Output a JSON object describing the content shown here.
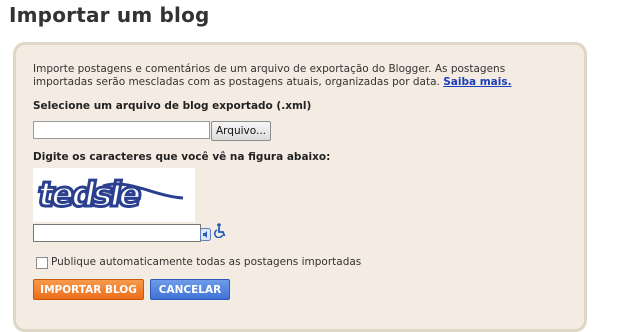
{
  "page": {
    "title": "Importar um blog"
  },
  "intro": {
    "text": "Importe postagens e comentários de um arquivo de exportação do Blogger. As postagens importadas serão mescladas com as postagens atuais, organizadas por data.",
    "link": "Saiba mais."
  },
  "file": {
    "label": "Selecione um arquivo de blog exportado (.xml)",
    "value": "",
    "button": "Arquivo..."
  },
  "captcha": {
    "label": "Digite os caracteres que você vê na figura abaixo:",
    "image_text": "tedsle",
    "value": ""
  },
  "autopublish": {
    "checked": false,
    "label": "Publique automaticamente todas as postagens importadas"
  },
  "actions": {
    "import": "IMPORTAR BLOG",
    "cancel": "CANCELAR"
  },
  "colors": {
    "panel_bg": "#f4ece2",
    "import_button": "#ec6d1a",
    "cancel_button": "#3f72d8",
    "link": "#1a3fb8"
  }
}
